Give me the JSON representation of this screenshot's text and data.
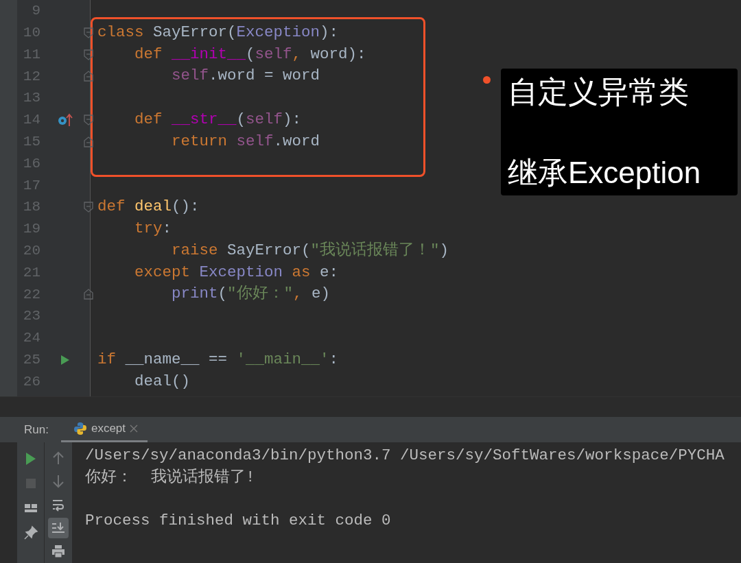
{
  "editor": {
    "lines": [
      {
        "number": "9"
      },
      {
        "number": "10",
        "gutter": [
          {
            "kind": "fold_start"
          }
        ],
        "tokens": [
          {
            "kind": "keyword",
            "text": "class "
          },
          {
            "kind": "plain",
            "text": "SayError("
          },
          {
            "kind": "builtin",
            "text": "Exception"
          },
          {
            "kind": "plain",
            "text": "):"
          }
        ]
      },
      {
        "number": "11",
        "gutter": [
          {
            "kind": "fold_start"
          }
        ],
        "tokens": [
          {
            "kind": "keyword",
            "text": "    def "
          },
          {
            "kind": "magic",
            "text": "__init__"
          },
          {
            "kind": "plain",
            "text": "("
          },
          {
            "kind": "self",
            "text": "self"
          },
          {
            "kind": "keyword",
            "text": ", "
          },
          {
            "kind": "plain",
            "text": "word):"
          }
        ]
      },
      {
        "number": "12",
        "gutter": [
          {
            "kind": "fold_end"
          }
        ],
        "tokens": [
          {
            "kind": "self",
            "text": "        self"
          },
          {
            "kind": "plain",
            "text": ".word = word"
          }
        ]
      },
      {
        "number": "13"
      },
      {
        "number": "14",
        "gutter": [
          {
            "kind": "override"
          },
          {
            "kind": "fold_start"
          }
        ],
        "tokens": [
          {
            "kind": "keyword",
            "text": "    def "
          },
          {
            "kind": "magic",
            "text": "__str__"
          },
          {
            "kind": "plain",
            "text": "("
          },
          {
            "kind": "self",
            "text": "self"
          },
          {
            "kind": "plain",
            "text": "):"
          }
        ]
      },
      {
        "number": "15",
        "gutter": [
          {
            "kind": "fold_end"
          }
        ],
        "tokens": [
          {
            "kind": "keyword",
            "text": "        return "
          },
          {
            "kind": "self",
            "text": "self"
          },
          {
            "kind": "plain",
            "text": ".word"
          }
        ]
      },
      {
        "number": "16"
      },
      {
        "number": "17"
      },
      {
        "number": "18",
        "gutter": [
          {
            "kind": "fold_start"
          }
        ],
        "tokens": [
          {
            "kind": "keyword",
            "text": "def "
          },
          {
            "kind": "funcdef",
            "text": "deal"
          },
          {
            "kind": "plain",
            "text": "():"
          }
        ]
      },
      {
        "number": "19",
        "tokens": [
          {
            "kind": "keyword",
            "text": "    try"
          },
          {
            "kind": "plain",
            "text": ":"
          }
        ]
      },
      {
        "number": "20",
        "tokens": [
          {
            "kind": "keyword",
            "text": "        raise "
          },
          {
            "kind": "plain",
            "text": "SayError("
          },
          {
            "kind": "string",
            "text": "\"我说话报错了！\""
          },
          {
            "kind": "plain",
            "text": ")"
          }
        ]
      },
      {
        "number": "21",
        "tokens": [
          {
            "kind": "keyword",
            "text": "    except "
          },
          {
            "kind": "builtin",
            "text": "Exception"
          },
          {
            "kind": "keyword",
            "text": " as "
          },
          {
            "kind": "plain",
            "text": "e:"
          }
        ]
      },
      {
        "number": "22",
        "gutter": [
          {
            "kind": "fold_end"
          }
        ],
        "tokens": [
          {
            "kind": "builtin",
            "text": "        print"
          },
          {
            "kind": "plain",
            "text": "("
          },
          {
            "kind": "string",
            "text": "\"你好：\""
          },
          {
            "kind": "keyword",
            "text": ", "
          },
          {
            "kind": "plain",
            "text": "e)"
          }
        ]
      },
      {
        "number": "23"
      },
      {
        "number": "24"
      },
      {
        "number": "25",
        "gutter": [
          {
            "kind": "run"
          }
        ],
        "tokens": [
          {
            "kind": "keyword",
            "text": "if "
          },
          {
            "kind": "plain",
            "text": "__name__ == "
          },
          {
            "kind": "string",
            "text": "'__main__'"
          },
          {
            "kind": "plain",
            "text": ":"
          }
        ]
      },
      {
        "number": "26",
        "tokens": [
          {
            "kind": "plain",
            "text": "    deal()"
          }
        ]
      }
    ]
  },
  "annotation": {
    "lines": [
      "自定义异常类",
      "继承Exception"
    ]
  },
  "run_panel": {
    "label": "Run:",
    "tabs": [
      {
        "label": "except",
        "selected": true
      }
    ],
    "left_toolbar": [
      {
        "kind": "run",
        "disabled": false
      },
      {
        "kind": "stop",
        "disabled": true
      },
      {
        "kind": "layout",
        "disabled": false
      },
      {
        "kind": "pin",
        "disabled": false
      }
    ],
    "right_toolbar": [
      {
        "kind": "up",
        "disabled": true,
        "on": false
      },
      {
        "kind": "down",
        "disabled": true,
        "on": false
      },
      {
        "kind": "wrap",
        "disabled": false,
        "on": false
      },
      {
        "kind": "scroll_end",
        "disabled": false,
        "on": true
      },
      {
        "kind": "print",
        "disabled": false,
        "on": false
      }
    ],
    "console": [
      {
        "text": "/Users/sy/anaconda3/bin/python3.7 /Users/sy/SoftWares/workspace/PYCHA"
      },
      {
        "text": "你好：  我说话报错了!"
      },
      {
        "text": "Process finished with exit code 0",
        "blank_before": true
      }
    ]
  }
}
